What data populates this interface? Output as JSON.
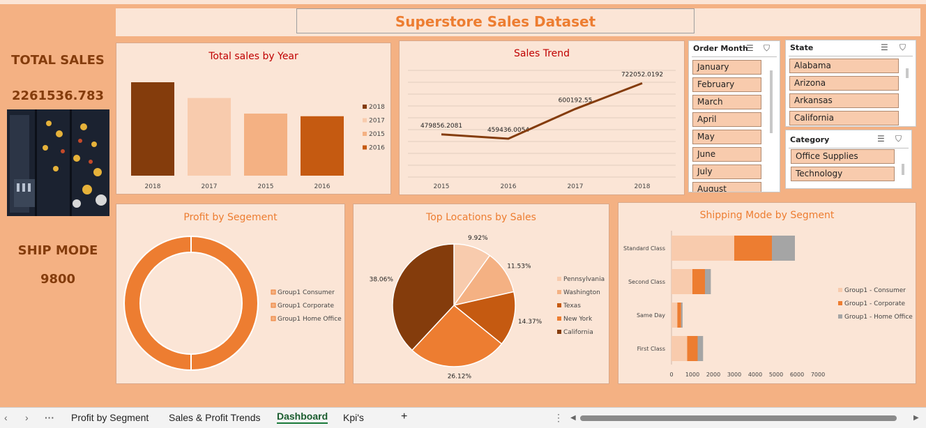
{
  "dashboard_title": "Superstore Sales Dataset",
  "kpis": {
    "total_sales_label": "TOTAL SALES",
    "total_sales_value": "2261536.783",
    "ship_mode_label": "SHIP MODE",
    "ship_mode_value": "9800"
  },
  "colors": {
    "dark_brown": "#843c0c",
    "light_peach": "#f8cbad",
    "peach": "#f4b183",
    "orange_brown": "#c55a11",
    "orange": "#ed7d31",
    "gray": "#a5a5a5",
    "panel_bg": "#fbe5d6"
  },
  "chart_data": [
    {
      "type": "bar",
      "title": "Total sales by Year",
      "categories": [
        "2018",
        "2017",
        "2015",
        "2016"
      ],
      "values": [
        722052.0192,
        600192.55,
        479856.2081,
        459436.0054
      ],
      "colors": [
        "#843c0c",
        "#f8cbad",
        "#f4b183",
        "#c55a11"
      ],
      "legend": [
        "2018",
        "2017",
        "2015",
        "2016"
      ],
      "legend_position": "right",
      "ylim": [
        0,
        800000
      ]
    },
    {
      "type": "line",
      "title": "Sales Trend",
      "x": [
        "2015",
        "2016",
        "2017",
        "2018"
      ],
      "values": [
        479856.2081,
        459436.0054,
        600192.55,
        722052.0192
      ],
      "data_labels": [
        "479856.2081",
        "459436.0054",
        "600192.55",
        "722052.0192"
      ],
      "grid": true,
      "ylim": [
        0,
        800000
      ]
    },
    {
      "type": "pie",
      "title": "Profit by Segement",
      "donut": true,
      "legend": [
        "Group1 Consumer",
        "Group1 Corporate",
        "Group1 Home Office"
      ],
      "values": [
        0.5,
        0.5
      ],
      "legend_position": "right"
    },
    {
      "type": "pie",
      "title": "Top Locations by Sales",
      "labels": [
        "Pennsylvania",
        "Washington",
        "Texas",
        "New York",
        "California"
      ],
      "values": [
        9.92,
        11.53,
        14.37,
        26.12,
        38.06
      ],
      "data_labels": [
        "9.92%",
        "11.53%",
        "14.37%",
        "26.12%",
        "38.06%"
      ],
      "colors": [
        "#f8cbad",
        "#f4b183",
        "#c55a11",
        "#ed7d31",
        "#843c0c"
      ],
      "legend_position": "right"
    },
    {
      "type": "bar",
      "orientation": "horizontal",
      "stacked": true,
      "title": "Shipping Mode by Segment",
      "categories": [
        "Standard Class",
        "Second Class",
        "Same Day",
        "First Class"
      ],
      "series": [
        {
          "name": "Group1 - Consumer",
          "values": [
            3000,
            1000,
            280,
            750
          ]
        },
        {
          "name": "Group1 - Corporate",
          "values": [
            1800,
            600,
            180,
            500
          ]
        },
        {
          "name": "Group1 - Home Office",
          "values": [
            1100,
            280,
            70,
            260
          ]
        }
      ],
      "colors": [
        "#f8cbad",
        "#ed7d31",
        "#a5a5a5"
      ],
      "xticks": [
        "0",
        "1000",
        "2000",
        "3000",
        "4000",
        "5000",
        "6000",
        "7000"
      ],
      "xlim": [
        0,
        7000
      ],
      "legend_position": "right"
    }
  ],
  "slicers": {
    "order_month": {
      "title": "Order Month",
      "items": [
        "January",
        "February",
        "March",
        "April",
        "May",
        "June",
        "July",
        "August"
      ]
    },
    "state": {
      "title": "State",
      "items": [
        "Alabama",
        "Arizona",
        "Arkansas",
        "California"
      ]
    },
    "category": {
      "title": "Category",
      "items": [
        "Office Supplies",
        "Technology"
      ]
    }
  },
  "sheet_tabs": {
    "more": "···",
    "tabs": [
      "Profit by Segment",
      "Sales & Profit Trends",
      "Dashboard",
      "Kpi's"
    ],
    "active": "Dashboard",
    "add": "+"
  }
}
